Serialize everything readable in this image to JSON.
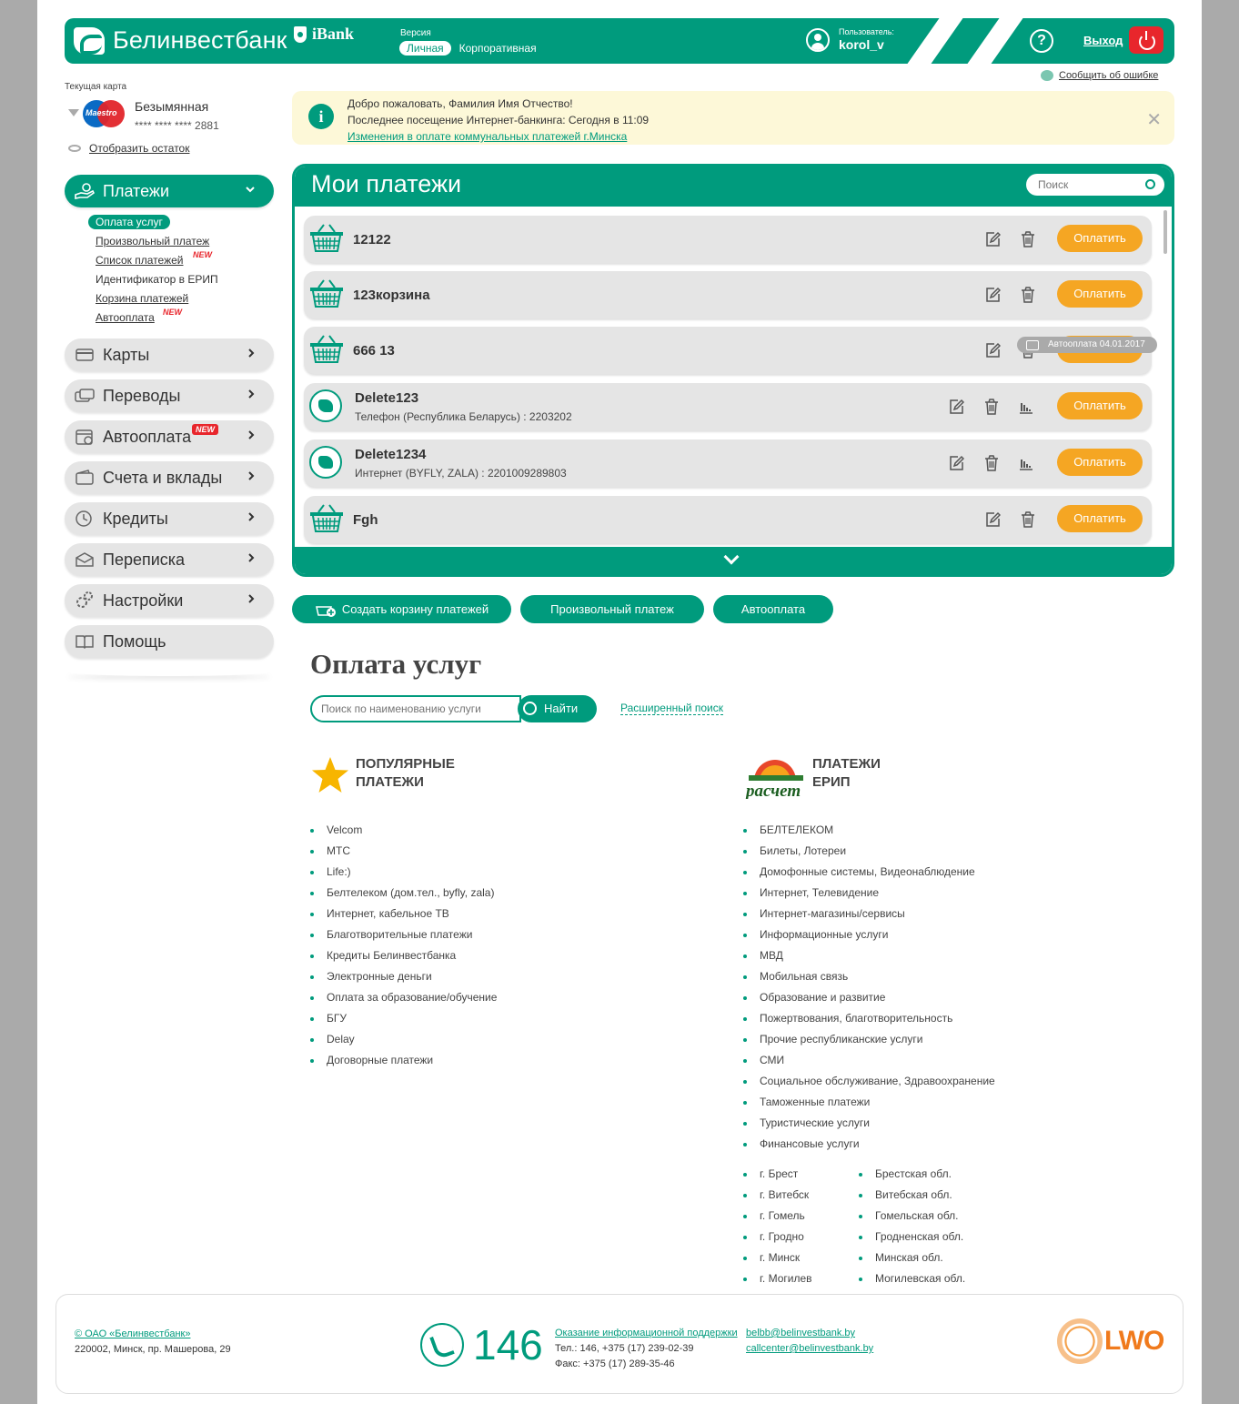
{
  "header": {
    "brand": "Белинвестбанк",
    "product": "iBank",
    "version_label": "Версия",
    "version_active": "Личная",
    "version_other": "Корпоративная",
    "user_label": "Пользователь:",
    "user_name": "korol_v",
    "help": "?",
    "logout": "Выход",
    "brand_color": "#009b7d",
    "logout_color": "#e8262c"
  },
  "report_error": "Сообщить об ошибке",
  "card": {
    "label": "Текущая карта",
    "brand": "Maestro",
    "name": "Безымянная",
    "number": "**** **** **** 2881",
    "show_balance": "Отобразить остаток"
  },
  "menu": {
    "payments": "Платежи",
    "submenu": [
      {
        "label": "Оплата услуг"
      },
      {
        "label": "Произвольный платеж"
      },
      {
        "label": "Список платежей",
        "tag": "NEW"
      },
      {
        "label": "Идентификатор в ЕРИП"
      },
      {
        "label": "Корзина платежей"
      },
      {
        "label": "Автооплата",
        "tag": "NEW"
      }
    ],
    "items": [
      {
        "label": "Карты",
        "icon": "card-icon"
      },
      {
        "label": "Переводы",
        "icon": "transfer-icon"
      },
      {
        "label": "Автооплата",
        "icon": "calendar-icon",
        "tag": "NEW"
      },
      {
        "label": "Счета и вклады",
        "icon": "wallet-icon"
      },
      {
        "label": "Кредиты",
        "icon": "credit-icon"
      },
      {
        "label": "Переписка",
        "icon": "mail-icon"
      },
      {
        "label": "Настройки",
        "icon": "gears-icon"
      },
      {
        "label": "Помощь",
        "icon": "book-icon"
      }
    ]
  },
  "notice": {
    "line1": "Добро пожаловать, Фамилия Имя Отчество!",
    "line2": "Последнее посещение Интернет-банкинга: Сегодня в 11:09",
    "link": "Изменения в оплате коммунальных платежей г.Минска"
  },
  "my_payments": {
    "title": "Мои платежи",
    "search_placeholder": "Поиск",
    "pay_label": "Оплатить",
    "autopay_badge": "Автооплата 04.01.2017",
    "rows": [
      {
        "name": "12122",
        "type": "basket"
      },
      {
        "name": "123корзина",
        "type": "basket"
      },
      {
        "name": "666 13",
        "type": "basket"
      },
      {
        "name": "Delete123",
        "type": "erip",
        "sub": "Телефон (Республика Беларусь) : 2203202"
      },
      {
        "name": "Delete1234",
        "type": "erip",
        "sub": "Интернет (BYFLY, ZALA) : 2201009289803"
      },
      {
        "name": "Fgh",
        "type": "basket"
      }
    ]
  },
  "actions": {
    "create_basket": "Создать корзину платежей",
    "arbitrary": "Произвольный платеж",
    "autopay": "Автооплата"
  },
  "services": {
    "title": "Оплата услуг",
    "search_placeholder": "Поиск по наименованию услуги",
    "find": "Найти",
    "advanced": "Расширенный поиск",
    "popular": {
      "title1": "ПОПУЛЯРНЫЕ",
      "title2": "ПЛАТЕЖИ",
      "items": [
        "Velcom",
        "МТС",
        "Life:)",
        "Белтелеком (дом.тел., byfly, zala)",
        "Интернет, кабельное ТВ",
        "Благотворительные платежи",
        "Кредиты Белинвестбанка",
        "Электронные деньги",
        "Оплата за образование/обучение",
        "БГУ",
        "Delay",
        "Договорные платежи"
      ]
    },
    "erip": {
      "logo_text": "расчет",
      "title1": "ПЛАТЕЖИ",
      "title2": "ЕРИП",
      "items": [
        "БЕЛТЕЛЕКОМ",
        "Билеты, Лотереи",
        "Домофонные системы, Видеонаблюдение",
        "Интернет, Телевидение",
        "Интернет-магазины/сервисы",
        "Информационные услуги",
        "МВД",
        "Мобильная связь",
        "Образование и развитие",
        "Пожертвования, благотворительность",
        "Прочие республиканские услуги",
        "СМИ",
        "Социальное обслуживание, Здравоохранение",
        "Таможенные платежи",
        "Туристические услуги",
        "Финансовые услуги"
      ],
      "cities": [
        "г. Брест",
        "г. Витебск",
        "г. Гомель",
        "г. Гродно",
        "г. Минск",
        "г. Могилев"
      ],
      "regions": [
        "Брестская обл.",
        "Витебская обл.",
        "Гомельская обл.",
        "Гродненская обл.",
        "Минская обл.",
        "Могилевская обл."
      ]
    }
  },
  "footer": {
    "copyright": "© ОАО «Белинвестбанк»",
    "address": "220002, Минск, пр. Машерова, 29",
    "phone": "146",
    "support_link": "Оказание информационной поддержки",
    "tel": "Тел.: 146, +375 (17) 239-02-39",
    "fax": "Факс: +375 (17) 289-35-46",
    "email1": "belbb@belinvestbank.by",
    "email2": "callcenter@belinvestbank.by",
    "partner_logo": "LWO"
  }
}
